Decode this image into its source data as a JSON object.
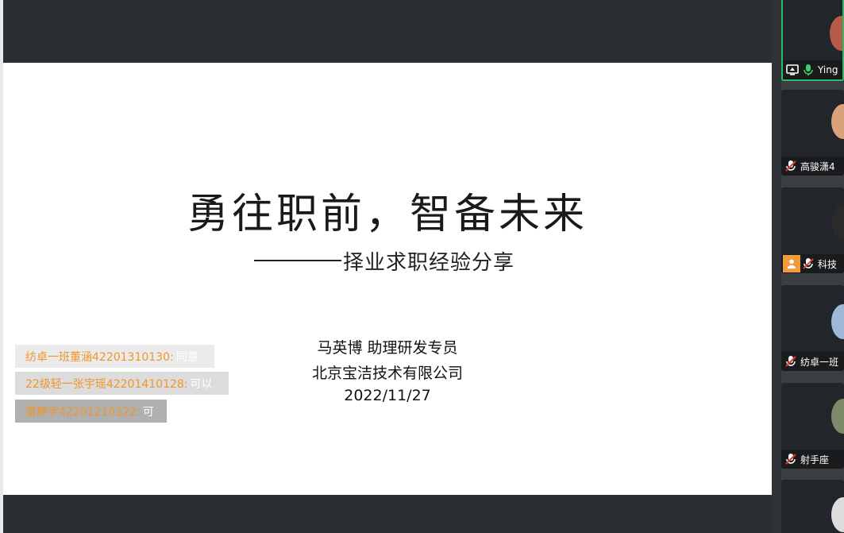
{
  "slide": {
    "title": "勇往职前，智备未来",
    "subtitle": "择业求职经验分享",
    "presenter_name": "马英博 助理研发专员",
    "presenter_company": "北京宝洁技术有限公司",
    "presenter_date": "2022/11/27"
  },
  "chat": [
    {
      "sender": "纺卓一班董涵42201310130:",
      "message": "同意"
    },
    {
      "sender": "22级轻一张宇瑶42201410128:",
      "message": "可以"
    },
    {
      "sender": "雷静宇42201210322:",
      "message": "可"
    }
  ],
  "participants": [
    {
      "name": "Ying",
      "avatar_color": "#b85a4a"
    },
    {
      "name": "高骏潇4",
      "avatar_color": "#d9a27a"
    },
    {
      "name": "科技",
      "avatar_color": "#2a2a2a"
    },
    {
      "name": "纺卓一班",
      "avatar_color": "#9fb8d9"
    },
    {
      "name": "射手座",
      "avatar_color": "#7c8a6a"
    },
    {
      "name": "",
      "avatar_color": "#dddddd"
    }
  ],
  "colors": {
    "active_border": "#2dbb6a",
    "chat_sender": "#f0952a",
    "mic_green": "#39d36b",
    "muted_red": "#e0392d"
  }
}
